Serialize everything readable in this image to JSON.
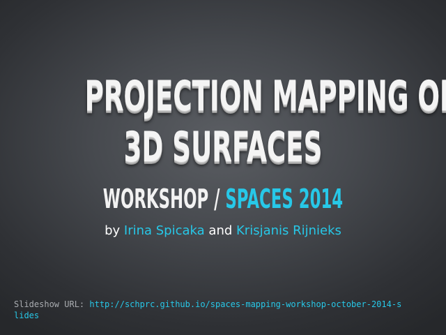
{
  "slide": {
    "title_line_1": "PROJECTION MAPPING ON",
    "title_line_2": "3D SURFACES",
    "subtitle_prefix": "WORKSHOP / ",
    "subtitle_event": "SPACES 2014",
    "byline_prefix": "by ",
    "author_1": "Irina Spicaka",
    "byline_and": " and ",
    "author_2": "Krisjanis Rijnieks",
    "url_label": "Slideshow URL: ",
    "url_link": "http://schprc.github.io/spaces-mapping-workshop-october-2014-slides"
  },
  "colors": {
    "accent": "#27c8e8",
    "title": "#f4f4f4",
    "background": "#46494e",
    "url_label": "#a9acb0"
  }
}
